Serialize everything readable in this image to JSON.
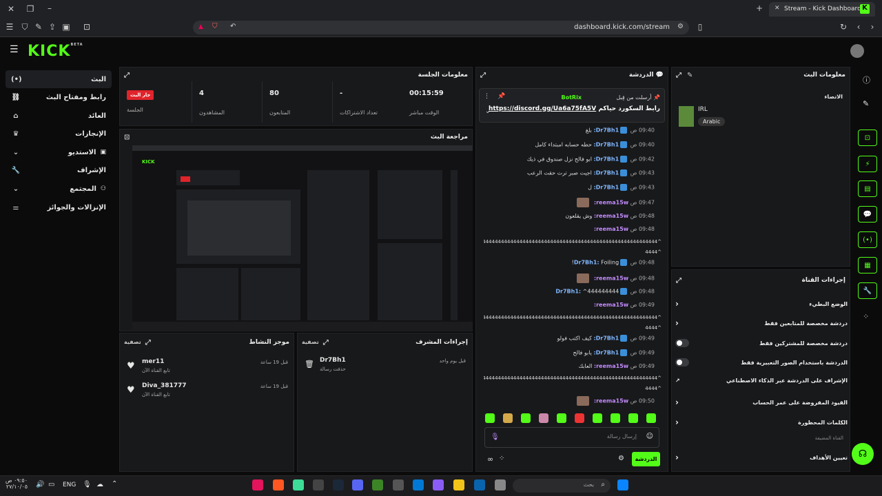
{
  "browser": {
    "tab_title": "Stream - Kick Dashboard",
    "url": "dashboard.kick.com/stream"
  },
  "brand": {
    "logo": "KICK",
    "beta": "BETA",
    "accent": "#53fc18"
  },
  "sidebar": {
    "items": [
      {
        "label": "البث",
        "icon": "broadcast-icon"
      },
      {
        "label": "رابط ومفتاح البث",
        "icon": "link-icon"
      },
      {
        "label": "العائد",
        "icon": "bank-icon"
      },
      {
        "label": "الإنجازات",
        "icon": "trophy-icon"
      },
      {
        "label": "الاستديو",
        "icon": "studio-icon"
      },
      {
        "label": "الإشراف",
        "icon": "wrench-icon"
      },
      {
        "label": "المجتمع",
        "icon": "community-icon"
      },
      {
        "label": "الإنزالات والجوائز",
        "icon": "drops-icon"
      }
    ]
  },
  "session": {
    "title": "معلومات الجلسة",
    "live_badge": "جار البث",
    "session_label": "الجلسة",
    "stats": [
      {
        "value": "00:15:59",
        "label": "الوقت مباشر"
      },
      {
        "value": "-",
        "label": "تعداد الاشتراكات"
      },
      {
        "value": "80",
        "label": "المتابعون"
      },
      {
        "value": "4",
        "label": "المشاهدون"
      }
    ]
  },
  "preview": {
    "title": "مراجعة البث"
  },
  "activity": {
    "title": "موجز النشاط",
    "filter": "تصفية",
    "items": [
      {
        "name": "mer11",
        "text": "تابع القناة الآن",
        "time": "قبل 19 ساعة"
      },
      {
        "name": "Diva_381777",
        "text": "تابع القناة الآن",
        "time": "قبل 19 ساعة"
      }
    ]
  },
  "modactions": {
    "title": "إجراءات المشرف",
    "filter": "تصفية",
    "items": [
      {
        "name": "Dr7Bh1",
        "text": "حذفت رسالة",
        "time": "قبل يوم واحد"
      }
    ]
  },
  "chat": {
    "title": "الدردشة",
    "pinned": {
      "by": "أرسلت من قِبل",
      "user": "BotRix",
      "text": "رابط السكورد حياكم",
      "link": "https://discord.gg/Ua6a75fA5V"
    },
    "messages": [
      {
        "time": "09:40 ص",
        "user": "Dr7Bh1",
        "text": "بلغ"
      },
      {
        "time": "09:40 ص",
        "user": "Dr7Bh1",
        "text": "حطه حسابه امبتداء كامل"
      },
      {
        "time": "09:42 ص",
        "user": "Dr7Bh1",
        "text": "ابو فالح نزل صندوق في ذيك"
      },
      {
        "time": "09:43 ص",
        "user": "Dr7Bh1",
        "text": "اجيت صبر ترت حقت الرعب"
      },
      {
        "time": "09:43 ص",
        "user": "Dr7Bh1",
        "text": "ل"
      },
      {
        "time": "09:47 ص",
        "user": "reema15w",
        "text": ""
      },
      {
        "time": "09:48 ص",
        "user": "reema15w",
        "text": "وش يقلعون"
      },
      {
        "time": "09:48 ص",
        "user": "reema15w",
        "text": ""
      },
      {
        "time": "09:48 ص",
        "user": "Dr7Bh1",
        "text": "Foiling!"
      },
      {
        "time": "09:48 ص",
        "user": "reema15w",
        "text": ""
      },
      {
        "time": "09:48 ص",
        "user": "Dr7Bh1",
        "text": "^444444444"
      },
      {
        "time": "09:49 ص",
        "user": "reema15w",
        "text": ""
      },
      {
        "time": "09:49 ص",
        "user": "Dr7Bh1",
        "text": "كيف اكتب فولو"
      },
      {
        "time": "09:49 ص",
        "user": "Dr7Bh1",
        "text": "يابو فالح"
      },
      {
        "time": "09:49 ص",
        "user": "reema15w",
        "text": "العابك"
      },
      {
        "time": "09:50 ص",
        "user": "reema15w",
        "text": ""
      }
    ],
    "hash_line": "^444444444444444444444444444444444444444444444444444444444444444444",
    "hash_tail": "^4444",
    "input_placeholder": "إرسال رسالة",
    "send_button": "الدردشة"
  },
  "stream_info": {
    "title": "معلومات البث",
    "category_label": "الاتصاء",
    "category": "IRL",
    "tag": "Arabic"
  },
  "quick_actions": {
    "title": "إجراءات القناة",
    "items": [
      {
        "label": "الوضع البطيء",
        "control": "chevron"
      },
      {
        "label": "دردشة مخصصة للمتابعين فقط",
        "control": "chevron"
      },
      {
        "label": "دردشة مخصصة للمشتركين فقط",
        "control": "toggle"
      },
      {
        "label": "الدردشة باستخدام الصور التعبيرية فقط",
        "control": "toggle"
      },
      {
        "label": "الإشراف على الدردشة عبر الذكاء الاصطناعي",
        "control": "external"
      },
      {
        "label": "القيود المفروضة على عمر الحساب",
        "control": "chevron"
      },
      {
        "label": "الكلمات المحظورة",
        "control": "chevron"
      }
    ],
    "section_label": "القناة المضيفة",
    "goals": "تعيين الأهداف"
  },
  "taskbar": {
    "search_placeholder": "بحث",
    "lang": "ENG",
    "time": "٠٩:٥٠ ص",
    "date": "٢٧/١٠/٠٥"
  }
}
